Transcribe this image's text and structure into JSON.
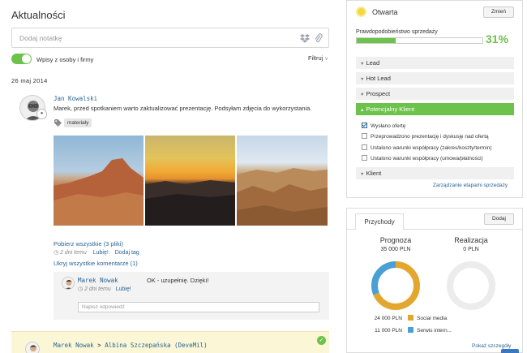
{
  "feed": {
    "title": "Aktualności",
    "note_placeholder": "Dodaj notatkę",
    "toggle_label": "Wpisy z osoby i firmy",
    "filter_label": "Filtruj",
    "date_heading": "26 maj 2014"
  },
  "post1": {
    "author": "Jan Kowalski",
    "text": "Marek, przed spotkaniem warto zaktualizować prezentację. Podsyłam zdjęcia do wykorzystania.",
    "tag": "materiały",
    "download_all": "Pobierz wszystkie (3 pliki)",
    "time": "2 dni temu",
    "like": "Lubię!",
    "add_tag": "Dodaj tag",
    "hide_comments": "Ukryj wszystkie komentarze (1)"
  },
  "comment": {
    "author": "Marek Nowak",
    "text": "OK - uzupełnię. Dzięki!",
    "time": "2 dni temu",
    "like": "Lubię!",
    "reply_placeholder": "Napisz odpowiedź"
  },
  "post2": {
    "author": "Marek Nowak",
    "arrow": ">",
    "recipient": "Albina Szczepańska (DeveMil)"
  },
  "deal": {
    "status": "Otwarta",
    "change_label": "Zmień",
    "probability_label": "Prawdopodobieństwo sprzedaży",
    "probability_text": "31%",
    "probability": 0.31,
    "stages": [
      {
        "label": "Lead",
        "active": false
      },
      {
        "label": "Hot Lead",
        "active": false
      },
      {
        "label": "Prospect",
        "active": false
      },
      {
        "label": "Potencjalny Klient",
        "active": true
      },
      {
        "label": "Klient",
        "active": false
      }
    ],
    "tasks": [
      {
        "label": "Wysłano ofertę",
        "checked": true
      },
      {
        "label": "Przeprowadzono prezentację i dyskusję nad ofertą",
        "checked": false
      },
      {
        "label": "Ustalono warunki współpracy (zakres/koszty/termin)",
        "checked": false
      },
      {
        "label": "Ustalono warunki współpracy (umowa/płatności)",
        "checked": false
      }
    ],
    "manage_label": "Zarządzanie etapami sprzedaży"
  },
  "revenue": {
    "tab_label": "Przychody",
    "add_label": "Dodaj",
    "forecast_label": "Prognoza",
    "forecast_value": "35 000 PLN",
    "realization_label": "Realizacja",
    "realization_value": "0 PLN",
    "legend": [
      {
        "amount": "24 000 PLN",
        "label": "Social media",
        "color": "#e3a72f",
        "value": 24000
      },
      {
        "amount": "11 000 PLN",
        "label": "Serwis intern...",
        "color": "#4a9fd5",
        "value": 11000
      }
    ],
    "show_more": "Pokaż szczegóły"
  },
  "colors": {
    "accent_green": "#6cc24a",
    "link_blue": "#2a6496",
    "donut_orange": "#e3a72f",
    "donut_blue": "#4a9fd5"
  }
}
